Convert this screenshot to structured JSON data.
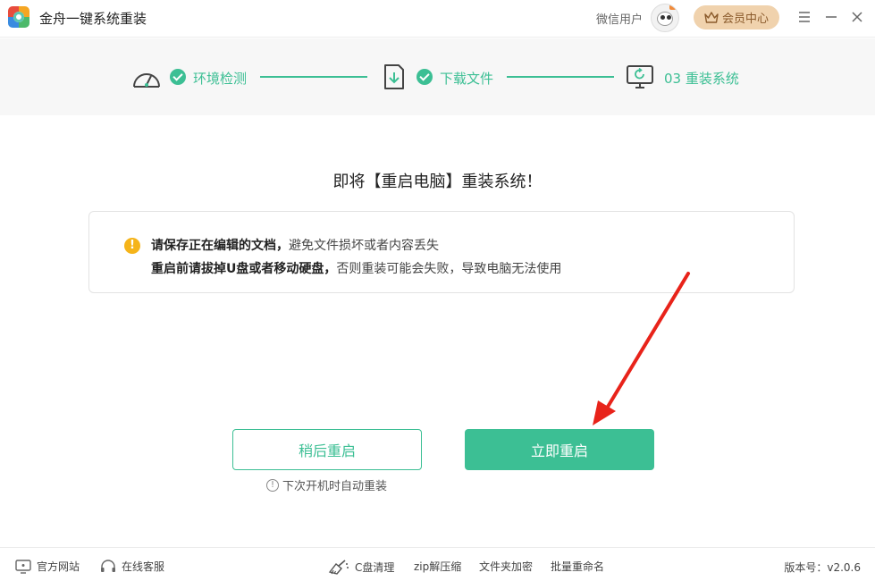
{
  "app": {
    "title": "金舟一键系统重装",
    "user_name": "微信用户",
    "vip_label": "会员中心"
  },
  "steps": [
    {
      "label": "环境检测"
    },
    {
      "label": "下载文件"
    },
    {
      "label": "03 重装系统"
    }
  ],
  "main": {
    "heading": "即将【重启电脑】重装系统！",
    "notice": {
      "line1_bold": "请保存正在编辑的文档，",
      "line1_rest": "避免文件损坏或者内容丢失",
      "line2_bold": "重启前请拔掉U盘或者移动硬盘，",
      "line2_rest": "否则重装可能会失败，导致电脑无法使用"
    },
    "later_button": "稍后重启",
    "now_button": "立即重启",
    "later_hint": "下次开机时自动重装"
  },
  "footer": {
    "website": "官方网站",
    "support": "在线客服",
    "tools": [
      "C盘清理",
      "zip解压缩",
      "文件夹加密",
      "批量重命名"
    ],
    "version": "版本号：v2.0.6"
  },
  "colors": {
    "accent": "#3cbf94",
    "warning": "#f5b41a",
    "arrow": "#e8231a",
    "vip_bg": "#f0d2ad"
  },
  "icons": [
    "logo-icon",
    "avatar",
    "crown-icon",
    "menu-icon",
    "minimize-icon",
    "gauge-icon",
    "download-file-icon",
    "reinstall-monitor-icon",
    "check-icon",
    "warning-icon",
    "info-icon",
    "monitor-icon",
    "headset-icon",
    "broom-icon"
  ]
}
